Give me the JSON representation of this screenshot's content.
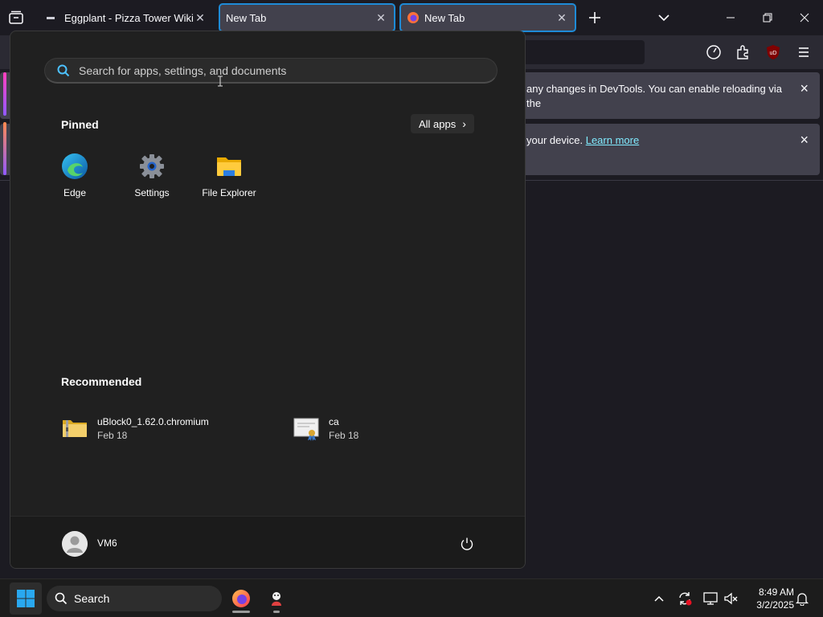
{
  "browser": {
    "tabs": [
      {
        "label": "Eggplant - Pizza Tower Wiki",
        "icon": "wiki-favicon-icon"
      },
      {
        "label": "New Tab",
        "icon": "none"
      },
      {
        "label": "New Tab",
        "icon": "firefox-icon"
      }
    ],
    "new_tab_icon": "plus-icon",
    "list_tabs_icon": "chevron-down-icon",
    "window_controls": [
      "minimize-icon",
      "restore-icon",
      "close-icon"
    ],
    "toolbar_icons": [
      "timer-icon",
      "extensions-icon",
      "ublock-icon",
      "menu-icon"
    ],
    "ublock_badge": "uD",
    "notifications": [
      {
        "text": "any changes in DevTools. You can enable reloading via the",
        "close": "×"
      },
      {
        "text": "your device.",
        "link": "Learn more",
        "close": "×"
      }
    ]
  },
  "start_menu": {
    "search_placeholder": "Search for apps, settings, and documents",
    "pinned_title": "Pinned",
    "all_apps_label": "All apps",
    "all_apps_chevron": "›",
    "pinned": [
      {
        "label": "Edge",
        "icon": "edge-icon"
      },
      {
        "label": "Settings",
        "icon": "settings-gear-icon"
      },
      {
        "label": "File Explorer",
        "icon": "folder-icon"
      }
    ],
    "recommended_title": "Recommended",
    "recommended": [
      {
        "name": "uBlock0_1.62.0.chromium",
        "date": "Feb 18",
        "icon": "zip-folder-icon"
      },
      {
        "name": "ca",
        "date": "Feb 18",
        "icon": "certificate-icon"
      }
    ],
    "user_name": "VM6",
    "power_icon": "power-icon"
  },
  "taskbar": {
    "search_label": "Search",
    "apps": [
      "firefox-icon",
      "app-icon"
    ],
    "tray_icons": [
      "chevron-up-icon",
      "sync-icon",
      "network-icon",
      "volume-muted-icon"
    ],
    "time": "8:49 AM",
    "date": "3/2/2025",
    "notifications_icon": "bell-icon"
  },
  "colors": {
    "start_bg": "#202020",
    "accent": "#1e8bd7",
    "link": "#80ebff"
  }
}
